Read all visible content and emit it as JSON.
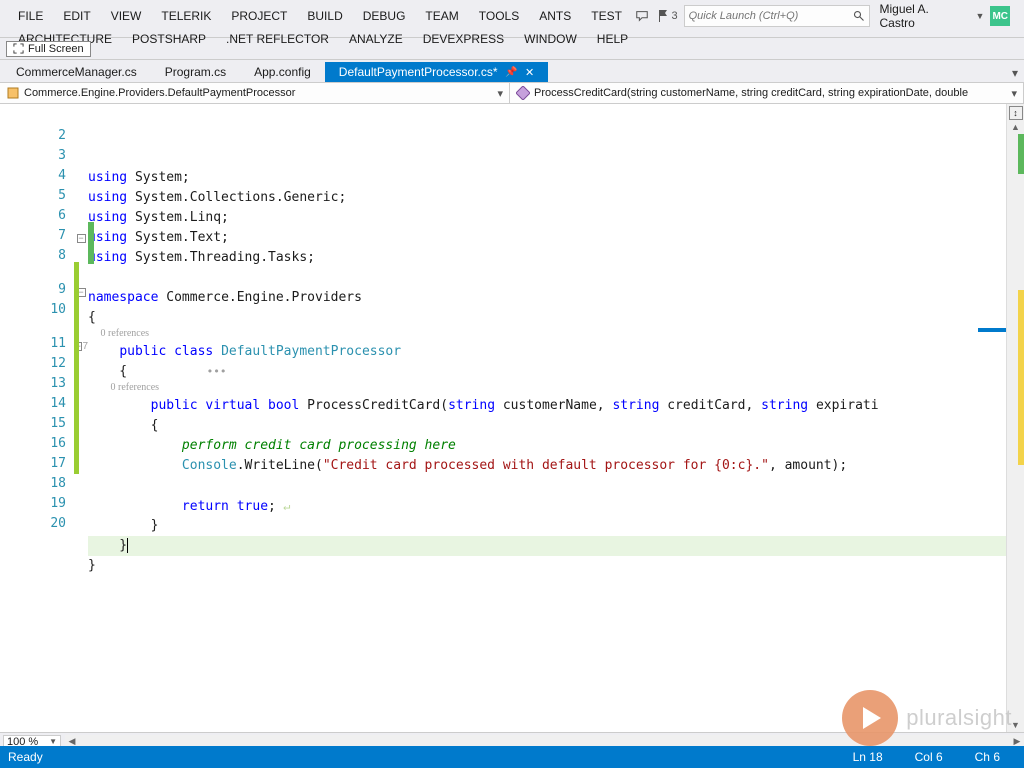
{
  "menu": {
    "row1": [
      "FILE",
      "EDIT",
      "VIEW",
      "TELERIK",
      "PROJECT",
      "BUILD",
      "DEBUG",
      "TEAM",
      "TOOLS",
      "ANTS",
      "TEST"
    ],
    "row2": [
      "ARCHITECTURE",
      "POSTSHARP",
      ".NET REFLECTOR",
      "ANALYZE",
      "DEVEXPRESS",
      "WINDOW",
      "HELP"
    ]
  },
  "titlebar": {
    "flag_count": "3",
    "quick_launch_placeholder": "Quick Launch (Ctrl+Q)",
    "user_name": "Miguel A. Castro",
    "user_initials": "MC"
  },
  "toolbar": {
    "fullscreen_label": "Full Screen"
  },
  "tabs": {
    "items": [
      {
        "label": "CommerceManager.cs",
        "active": false
      },
      {
        "label": "Program.cs",
        "active": false
      },
      {
        "label": "App.config",
        "active": false
      },
      {
        "label": "DefaultPaymentProcessor.cs*",
        "active": true
      }
    ]
  },
  "nav": {
    "left_icon": "class-icon",
    "left_text": "Commerce.Engine.Providers.DefaultPaymentProcessor",
    "right_icon": "method-icon",
    "right_text": "ProcessCreditCard(string customerName, string creditCard, string expirationDate, double"
  },
  "code": {
    "lines": [
      {
        "n": " ",
        "frag": [
          {
            "t": "using ",
            "c": "kw"
          },
          {
            "t": "System;",
            "c": ""
          }
        ]
      },
      {
        "n": "2",
        "frag": [
          {
            "t": "using ",
            "c": "kw"
          },
          {
            "t": "System.Collections.Generic;",
            "c": ""
          }
        ]
      },
      {
        "n": "3",
        "frag": [
          {
            "t": "using ",
            "c": "kw"
          },
          {
            "t": "System.Linq;",
            "c": ""
          }
        ]
      },
      {
        "n": "4",
        "frag": [
          {
            "t": "using ",
            "c": "kw"
          },
          {
            "t": "System.Text;",
            "c": ""
          }
        ]
      },
      {
        "n": "5",
        "frag": [
          {
            "t": "using ",
            "c": "kw"
          },
          {
            "t": "System.Threading.Tasks;",
            "c": ""
          }
        ]
      },
      {
        "n": "6",
        "frag": [
          {
            "t": "",
            "c": ""
          }
        ]
      },
      {
        "n": "7",
        "frag": [
          {
            "t": "namespace ",
            "c": "kw"
          },
          {
            "t": "Commerce.Engine.Providers",
            "c": ""
          }
        ]
      },
      {
        "n": "8",
        "frag": [
          {
            "t": "{",
            "c": ""
          }
        ]
      },
      {
        "n": "",
        "refc": "0 references",
        "indent": "     "
      },
      {
        "n": "9",
        "frag": [
          {
            "t": "    ",
            "c": ""
          },
          {
            "t": "public class ",
            "c": "kw"
          },
          {
            "t": "DefaultPaymentProcessor",
            "c": "typ"
          }
        ],
        "bulb": true
      },
      {
        "n": "10",
        "frag": [
          {
            "t": "    {",
            "c": ""
          }
        ],
        "dots": true
      },
      {
        "n": "",
        "refc": "0 references",
        "indent": "         "
      },
      {
        "n": "11",
        "frag": [
          {
            "t": "        ",
            "c": ""
          },
          {
            "t": "public virtual bool ",
            "c": "kw"
          },
          {
            "t": "ProcessCreditCard(",
            "c": ""
          },
          {
            "t": "string ",
            "c": "kw"
          },
          {
            "t": "customerName, ",
            "c": ""
          },
          {
            "t": "string ",
            "c": "kw"
          },
          {
            "t": "creditCard, ",
            "c": ""
          },
          {
            "t": "string ",
            "c": "kw"
          },
          {
            "t": "expirati",
            "c": ""
          }
        ],
        "bulb": true,
        "seven": true
      },
      {
        "n": "12",
        "frag": [
          {
            "t": "        {",
            "c": ""
          }
        ]
      },
      {
        "n": "13",
        "frag": [
          {
            "t": "            ",
            "c": ""
          },
          {
            "t": "perform credit card processing here",
            "c": "com"
          }
        ],
        "chat": true
      },
      {
        "n": "14",
        "frag": [
          {
            "t": "            ",
            "c": ""
          },
          {
            "t": "Console",
            "c": "typ"
          },
          {
            "t": ".WriteLine(",
            "c": ""
          },
          {
            "t": "\"Credit card processed with default processor for {0:c}.\"",
            "c": "str"
          },
          {
            "t": ", amount);",
            "c": ""
          }
        ]
      },
      {
        "n": "15",
        "frag": [
          {
            "t": "",
            "c": ""
          }
        ]
      },
      {
        "n": "16",
        "frag": [
          {
            "t": "            ",
            "c": ""
          },
          {
            "t": "return true",
            "c": "kw"
          },
          {
            "t": ";",
            "c": ""
          }
        ],
        "ret": true
      },
      {
        "n": "17",
        "frag": [
          {
            "t": "        }",
            "c": ""
          }
        ]
      },
      {
        "n": "18",
        "frag": [
          {
            "t": "    }",
            "c": ""
          }
        ],
        "hl": true,
        "caret": true
      },
      {
        "n": "19",
        "frag": [
          {
            "t": "}",
            "c": ""
          }
        ]
      },
      {
        "n": "20",
        "frag": [
          {
            "t": "",
            "c": ""
          }
        ]
      }
    ]
  },
  "zoom": {
    "value": "100 %"
  },
  "status": {
    "ready": "Ready",
    "ln": "Ln 18",
    "col": "Col 6",
    "ch": "Ch 6"
  },
  "watermark": {
    "text": "pluralsight"
  }
}
